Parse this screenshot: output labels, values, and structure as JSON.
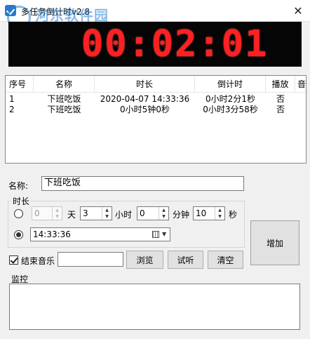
{
  "window": {
    "title": "多任务倒计时v2.8",
    "close_glyph": "✕",
    "watermark_site": "河东软件园",
    "watermark_url": "www.pc0359.cn"
  },
  "clock": {
    "display": "00:02:01"
  },
  "task_list": {
    "columns": [
      "序号",
      "名称",
      "时长",
      "倒计时",
      "播放",
      "音"
    ],
    "rows": [
      {
        "index": "1",
        "name": "下班吃饭",
        "duration": "2020-04-07  14:33:36",
        "countdown": "0小时2分1秒",
        "play": "否"
      },
      {
        "index": "2",
        "name": "下班吃饭",
        "duration": "0小时5钟0秒",
        "countdown": "0小时3分58秒",
        "play": "否"
      }
    ]
  },
  "form": {
    "name_label": "名称:",
    "name_value": "下班吃饭",
    "duration_group_label": "时长",
    "days_value": "0",
    "days_unit": "天",
    "hours_value": "3",
    "hours_unit": "小时",
    "minutes_value": "0",
    "minutes_unit": "分钟",
    "seconds_value": "10",
    "seconds_unit": "秒",
    "time_value": "14:33:36",
    "add_label": "增加",
    "music_label": "结束音乐",
    "music_value": "",
    "browse_label": "浏览",
    "test_label": "试听",
    "clear_label": "清空",
    "monitor_label": "监控"
  },
  "colors": {
    "led_red": "#ff2121",
    "led_background": "#050505"
  },
  "icons": {
    "up": "▲",
    "down": "▼",
    "dropdown": "▼"
  }
}
